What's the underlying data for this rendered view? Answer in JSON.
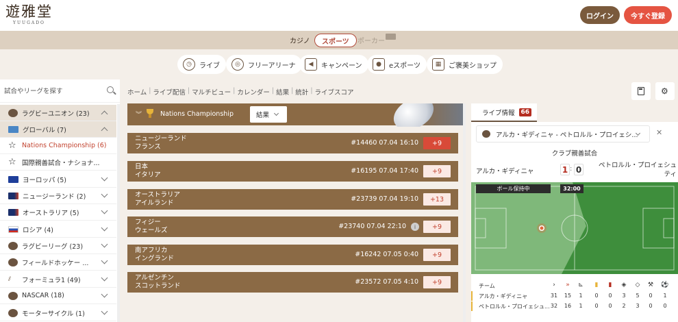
{
  "header": {
    "logo_kanji": "遊雅堂",
    "logo_roman": "YUUGADO",
    "login_label": "ログイン",
    "register_label": "今すぐ登録"
  },
  "modes": {
    "casino": "カジノ",
    "sports": "スポーツ",
    "poker": "ポーカー"
  },
  "categories": [
    {
      "label": "ライブ",
      "icon": "stopwatch-icon"
    },
    {
      "label": "フリーアリーナ",
      "icon": "target-icon"
    },
    {
      "label": "キャンペーン",
      "icon": "megaphone-icon"
    },
    {
      "label": "eスポーツ",
      "icon": "gamepad-icon"
    },
    {
      "label": "ご褒美ショップ",
      "icon": "shop-icon"
    }
  ],
  "sidebar": {
    "search_placeholder": "試合やリーグを探す",
    "items": [
      {
        "label": "ラグビーユニオン (23)",
        "icon": "rugby-ball-icon"
      },
      {
        "label": "グローバル (7)",
        "icon": "world-map-icon"
      },
      {
        "label": "Nations Championship (6)",
        "icon": "star-icon"
      },
      {
        "label": "国際親善試合・ナショナ...",
        "icon": "star-icon"
      },
      {
        "label": "ヨーロッパ (5)",
        "icon": "eu-flag-icon"
      },
      {
        "label": "ニュージーランド (2)",
        "icon": "nz-flag-icon"
      },
      {
        "label": "オーストラリア (5)",
        "icon": "au-flag-icon"
      },
      {
        "label": "ロシア (4)",
        "icon": "ru-flag-icon"
      },
      {
        "label": "ラグビーリーグ (23)",
        "icon": "rugby-ball-icon"
      },
      {
        "label": "フィールドホッケー ...",
        "icon": "hockey-ball-icon"
      },
      {
        "label": "フォーミュラ1 (49)",
        "icon": "f1-icon"
      },
      {
        "label": "NASCAR (18)",
        "icon": "nascar-icon"
      },
      {
        "label": "モーターサイクル (1)",
        "icon": "motorcycle-icon"
      }
    ]
  },
  "breadcrumb": [
    "ホーム",
    "ライブ配信",
    "マルチビュー",
    "カレンダー",
    "結果",
    "統計",
    "ライブスコア"
  ],
  "banner": {
    "title": "Nations Championship",
    "select_label": "結果"
  },
  "matches": [
    {
      "home": "ニュージーランド",
      "away": "フランス",
      "info": "#14460  07.04  16:10",
      "odds": "+9"
    },
    {
      "home": "日本",
      "away": "イタリア",
      "info": "#16195  07.04  17:40",
      "odds": "+9"
    },
    {
      "home": "オーストラリア",
      "away": "アイルランド",
      "info": "#23739  07.04  19:10",
      "odds": "+13"
    },
    {
      "home": "フィジー",
      "away": "ウェールズ",
      "info": "#23740  07.04  22:10",
      "odds": "+9"
    },
    {
      "home": "南アフリカ",
      "away": "イングランド",
      "info": "#16242  07.05  0:40",
      "odds": "+9"
    },
    {
      "home": "アルゼンチン",
      "away": "スコットランド",
      "info": "#23572  07.05  4:10",
      "odds": "+9"
    }
  ],
  "live": {
    "tab_label": "ライブ情報",
    "badge": "66",
    "selected_match": "アルカ・ギディニャ - ペトロルル・プロイェシ...",
    "competition": "クラブ親善試合",
    "home": "アルカ・ギディニャ",
    "away": "ペトロルル・プロイェシュティ",
    "home_score": "1",
    "away_score": "0",
    "possession_label": "ボール保持中",
    "clock": "32:00",
    "stats_header": "チーム",
    "stat_icons": [
      "shots-icon",
      "shots-on-target-icon",
      "corner-icon",
      "yellow-card-icon",
      "red-card-icon",
      "dangerous-attack-icon",
      "attack-icon",
      "penalty-icon",
      "goal-icon"
    ],
    "stats": [
      {
        "team": "アルカ・ギディニャ",
        "values": [
          "31",
          "15",
          "1",
          "0",
          "0",
          "3",
          "5",
          "0",
          "1"
        ]
      },
      {
        "team": "ペトロルル・プロイェシュ...",
        "values": [
          "32",
          "16",
          "1",
          "0",
          "0",
          "2",
          "3",
          "0",
          "0"
        ]
      }
    ]
  }
}
